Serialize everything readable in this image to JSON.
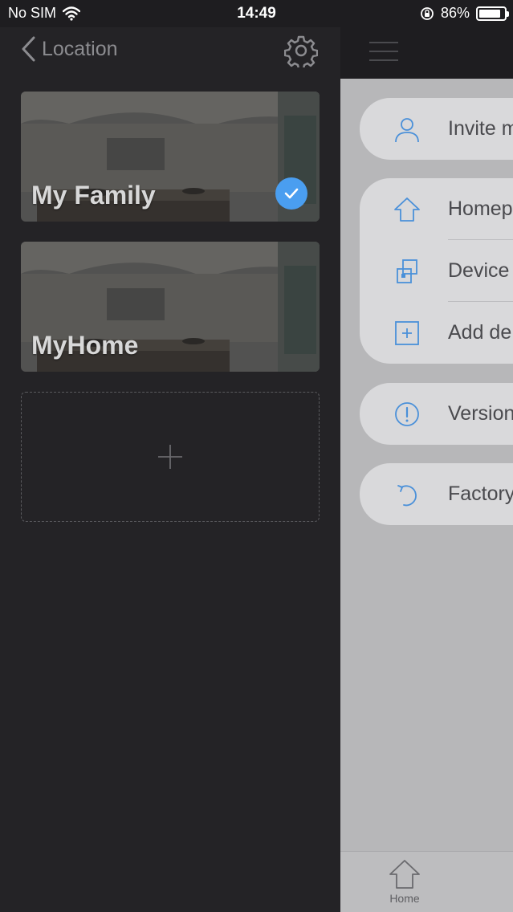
{
  "status": {
    "carrier": "No SIM",
    "time": "14:49",
    "battery": "86%",
    "battery_level": 0.86
  },
  "drawer": {
    "back_title": "Location",
    "locations": [
      {
        "name": "My Family",
        "selected": true
      },
      {
        "name": "MyHome",
        "selected": false
      }
    ]
  },
  "main": {
    "menu_groups": [
      [
        {
          "label": "Invite m",
          "icon": "person-icon"
        }
      ],
      [
        {
          "label": "Homep",
          "icon": "house-icon"
        },
        {
          "label": "Device",
          "icon": "devices-icon"
        },
        {
          "label": "Add de",
          "icon": "plus-square-icon"
        }
      ],
      [
        {
          "label": "Version",
          "icon": "info-icon"
        }
      ],
      [
        {
          "label": "Factory",
          "icon": "reset-icon"
        }
      ]
    ],
    "tab_home_label": "Home"
  },
  "colors": {
    "accent": "#4a9ef0",
    "drawer_bg": "#242326",
    "panel_bg": "#b7b7b9"
  }
}
